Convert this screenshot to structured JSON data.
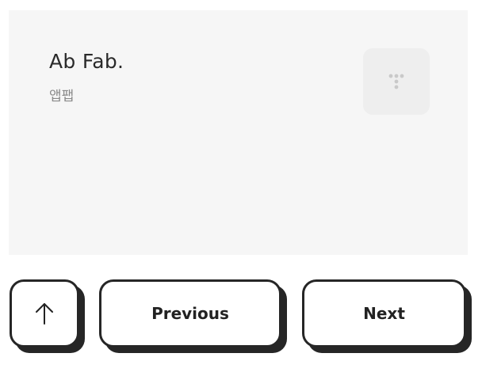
{
  "card": {
    "title": "Ab Fab.",
    "subtitle": "앱팹",
    "logo_icon": "dots-t-logo-icon"
  },
  "nav": {
    "up_icon": "arrow-up-icon",
    "previous_label": "Previous",
    "next_label": "Next"
  },
  "colors": {
    "card_bg": "#f6f6f6",
    "logo_bg": "#eeeeee",
    "button_border": "#262626",
    "text": "#2a2a2a",
    "subtitle": "#8a8a8a"
  }
}
